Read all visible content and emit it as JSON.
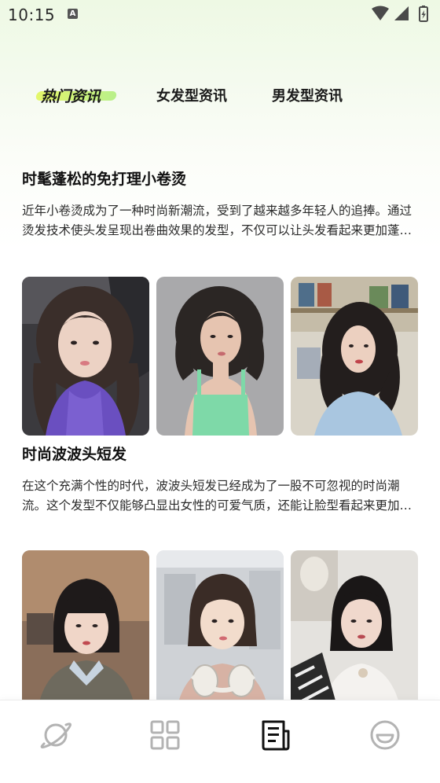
{
  "status_bar": {
    "time": "10:15",
    "notification_badge": "A"
  },
  "tabs": [
    {
      "label": "热门资讯",
      "active": true
    },
    {
      "label": "女发型资讯",
      "active": false
    },
    {
      "label": "男发型资讯",
      "active": false
    }
  ],
  "articles": [
    {
      "title": "时髦蓬松的免打理小卷烫",
      "description": "近年小卷烫成为了一种时尚新潮流，受到了越来越多年轻人的追捧。通过烫发技术使头发呈现出卷曲效果的发型，不仅可以让头发看起来更加蓬松有型。"
    },
    {
      "title": "时尚波波头短发",
      "description": "在这个充满个性的时代，波波头短发已经成为了一股不可忽视的时尚潮流。这个发型不仅能够凸显出女性的可爱气质，还能让脸型看起来更加小巧精致。"
    }
  ],
  "bottom_nav": [
    {
      "icon": "planet-icon",
      "active": false
    },
    {
      "icon": "grid-icon",
      "active": false
    },
    {
      "icon": "news-icon",
      "active": true
    },
    {
      "icon": "smile-icon",
      "active": false
    }
  ],
  "colors": {
    "tab_highlight": "#d7f56a",
    "nav_icon": "#b3b3b3",
    "nav_icon_active": "#111111"
  }
}
